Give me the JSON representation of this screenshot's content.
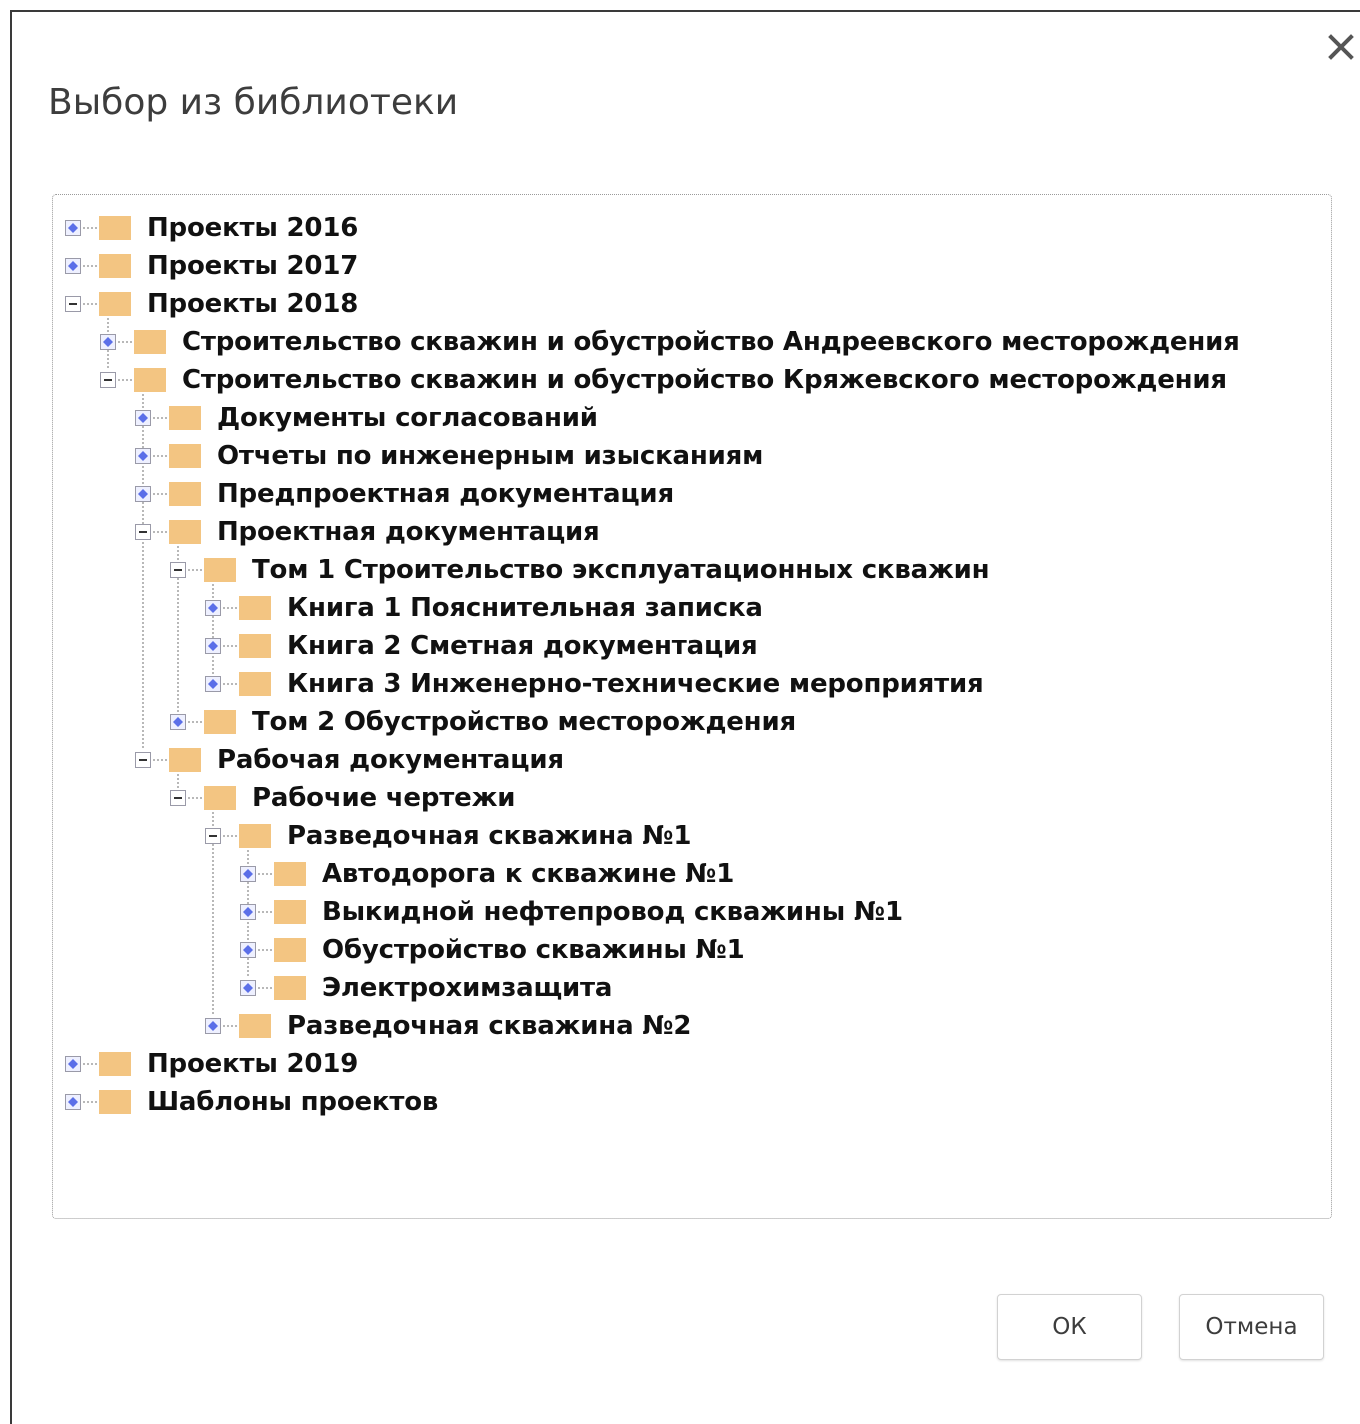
{
  "dialog": {
    "title": "Выбор из библиотеки",
    "close_icon": "close-icon",
    "ok_label": "ОК",
    "cancel_label": "Отмена"
  },
  "colors": {
    "folder": "#f3c582",
    "expander_blue": "#5b6fe8",
    "tree_lines": "#a0a0a0"
  },
  "tree": [
    {
      "label": "Проекты 2016",
      "level": 0,
      "expanded": false
    },
    {
      "label": "Проекты 2017",
      "level": 0,
      "expanded": false
    },
    {
      "label": "Проекты 2018",
      "level": 0,
      "expanded": true
    },
    {
      "label": "Строительство скважин и обустройство Андреевского месторождения",
      "level": 1,
      "expanded": false
    },
    {
      "label": "Строительство скважин и обустройство Кряжевского месторождения",
      "level": 1,
      "expanded": true
    },
    {
      "label": "Документы согласований",
      "level": 2,
      "expanded": false
    },
    {
      "label": "Отчеты по инженерным изысканиям",
      "level": 2,
      "expanded": false
    },
    {
      "label": "Предпроектная документация",
      "level": 2,
      "expanded": false
    },
    {
      "label": "Проектная документация",
      "level": 2,
      "expanded": true
    },
    {
      "label": "Том 1 Строительство эксплуатационных скважин",
      "level": 3,
      "expanded": true
    },
    {
      "label": "Книга 1 Пояснительная записка",
      "level": 4,
      "expanded": false
    },
    {
      "label": "Книга 2 Сметная документация",
      "level": 4,
      "expanded": false
    },
    {
      "label": "Книга 3 Инженерно-технические мероприятия",
      "level": 4,
      "expanded": false
    },
    {
      "label": "Том 2 Обустройство месторождения",
      "level": 3,
      "expanded": false
    },
    {
      "label": "Рабочая документация",
      "level": 2,
      "expanded": true
    },
    {
      "label": "Рабочие чертежи",
      "level": 3,
      "expanded": true
    },
    {
      "label": "Разведочная скважина №1",
      "level": 4,
      "expanded": true
    },
    {
      "label": "Автодорога к скважине №1",
      "level": 5,
      "expanded": false
    },
    {
      "label": "Выкидной нефтепровод скважины №1",
      "level": 5,
      "expanded": false
    },
    {
      "label": "Обустройство скважины №1",
      "level": 5,
      "expanded": false
    },
    {
      "label": "Электрохимзащита",
      "level": 5,
      "expanded": false
    },
    {
      "label": "Разведочная скважина №2",
      "level": 4,
      "expanded": false
    },
    {
      "label": "Проекты 2019",
      "level": 0,
      "expanded": false
    },
    {
      "label": "Шаблоны проектов",
      "level": 0,
      "expanded": false
    }
  ]
}
